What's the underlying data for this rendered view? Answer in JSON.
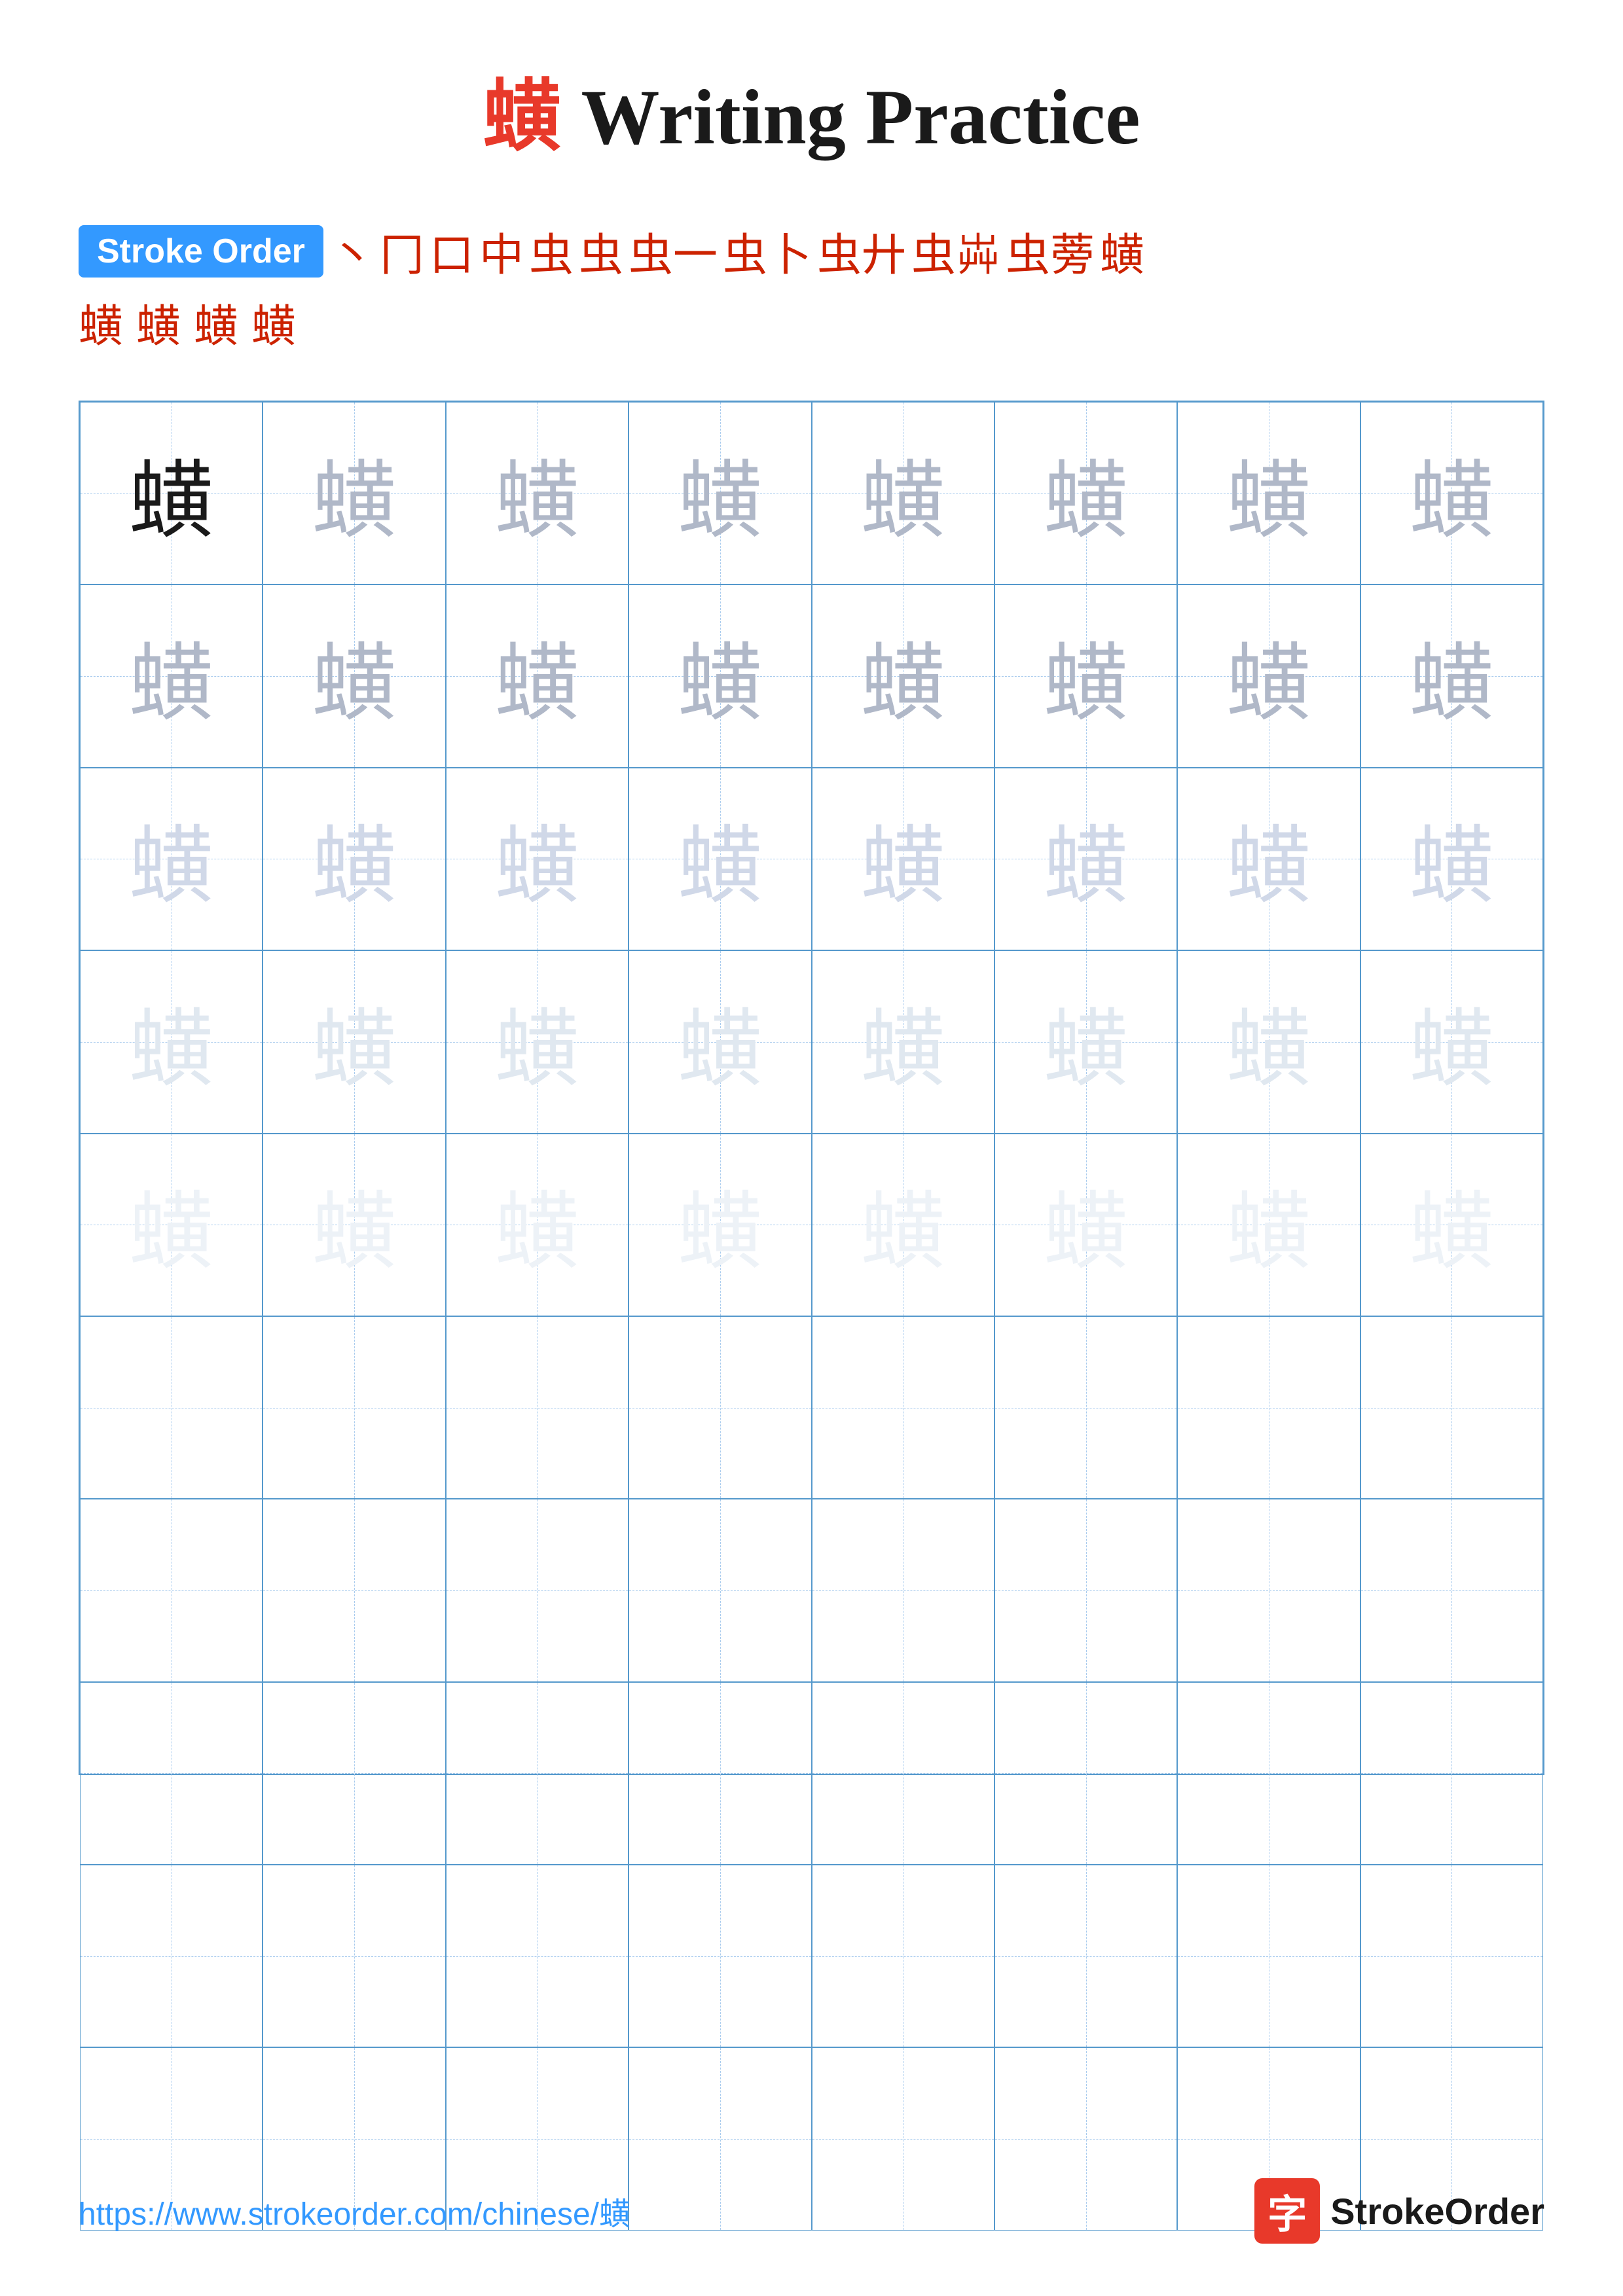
{
  "title": {
    "char": "蟥",
    "suffix": " Writing Practice"
  },
  "stroke_order": {
    "badge_label": "Stroke Order",
    "chars_row1": [
      "丶",
      "冂",
      "口",
      "中",
      "虫",
      "虫",
      "虫一",
      "虫卜",
      "虫廾",
      "虫芔",
      "虫蒡",
      "蟥"
    ],
    "chars_row2": [
      "蟥",
      "蟥",
      "蟥",
      "蟥"
    ]
  },
  "grid": {
    "char": "蟥",
    "cols": 8,
    "rows": 10,
    "shading": [
      "dark",
      "medium",
      "light",
      "light",
      "very-light",
      "very-light",
      "ultra-light",
      "ultra-light",
      "ultra-light",
      "ultra-light"
    ]
  },
  "footer": {
    "url": "https://www.strokeorder.com/chinese/蟥",
    "logo_char": "字",
    "logo_text": "StrokeOrder"
  }
}
